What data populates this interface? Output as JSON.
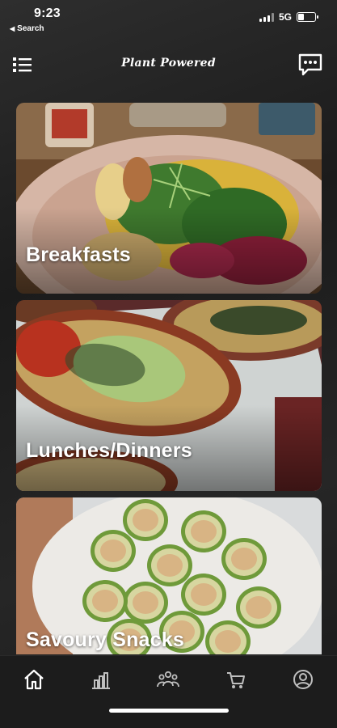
{
  "status_bar": {
    "time": "9:23",
    "back_label": "Search",
    "network": "5G",
    "battery_level": 0.35
  },
  "header": {
    "brand": "Plant Powered",
    "menu_icon": "list-menu-icon",
    "chat_icon": "chat-bubble-icon"
  },
  "categories": [
    {
      "label": "Breakfasts",
      "image": "breakfast-plate-photo"
    },
    {
      "label": "Lunches/Dinners",
      "image": "stuffed-sweet-potato-photo"
    },
    {
      "label": "Savoury Snacks",
      "image": "cucumber-bites-photo"
    }
  ],
  "bottom_nav": [
    {
      "icon": "home-icon",
      "active": true
    },
    {
      "icon": "bar-chart-icon",
      "active": false
    },
    {
      "icon": "community-icon",
      "active": false
    },
    {
      "icon": "cart-icon",
      "active": false
    },
    {
      "icon": "profile-icon",
      "active": false
    }
  ],
  "colors": {
    "background": "#1f1f1f",
    "nav_background": "#1c1c1c",
    "text": "#ffffff",
    "icon_inactive": "#bfbfbf"
  }
}
